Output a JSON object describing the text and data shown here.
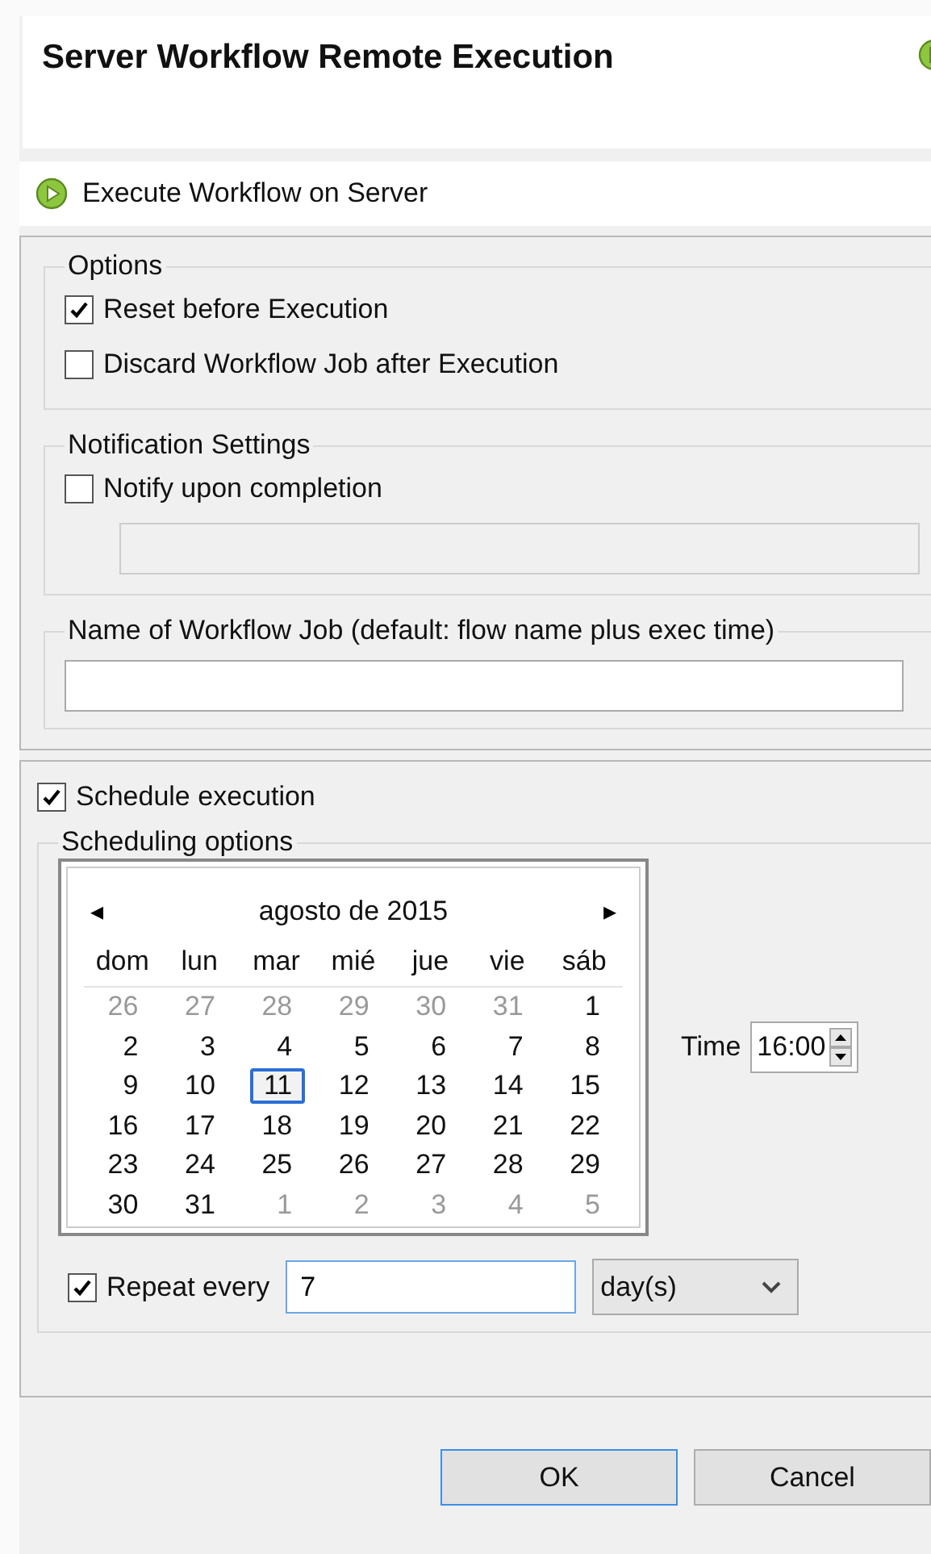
{
  "header": {
    "title": "Server Workflow Remote Execution"
  },
  "action": {
    "label": "Execute Workflow on Server"
  },
  "options": {
    "title": "Options",
    "items": [
      {
        "label": "Reset before Execution",
        "checked": true
      },
      {
        "label": "Discard Workflow Job after Execution",
        "checked": false
      }
    ]
  },
  "notification": {
    "title": "Notification Settings",
    "label": "Notify upon completion",
    "checked": false,
    "disabled": true
  },
  "job_name": {
    "title": "Name of Workflow Job (default: flow name plus exec time)"
  },
  "schedule": {
    "label": "Schedule execution",
    "checked": true,
    "title": "Scheduling options",
    "calendar": {
      "prev": "◂",
      "next": "▸",
      "month": "agosto de 2015",
      "weekdays": [
        "dom",
        "lun",
        "mar",
        "mié",
        "jue",
        "vie",
        "sáb"
      ],
      "days": [
        {
          "day": "26",
          "muted": true,
          "selected": false
        },
        {
          "day": "27",
          "muted": true,
          "selected": false
        },
        {
          "day": "28",
          "muted": true,
          "selected": false
        },
        {
          "day": "29",
          "muted": true,
          "selected": false
        },
        {
          "day": "30",
          "muted": true,
          "selected": false
        },
        {
          "day": "31",
          "muted": true,
          "selected": false
        },
        {
          "day": "1",
          "muted": false,
          "selected": false
        },
        {
          "day": "2",
          "muted": false,
          "selected": false
        },
        {
          "day": "3",
          "muted": false,
          "selected": false
        },
        {
          "day": "4",
          "muted": false,
          "selected": false
        },
        {
          "day": "5",
          "muted": false,
          "selected": false
        },
        {
          "day": "6",
          "muted": false,
          "selected": false
        },
        {
          "day": "7",
          "muted": false,
          "selected": false
        },
        {
          "day": "8",
          "muted": false,
          "selected": false
        },
        {
          "day": "9",
          "muted": false,
          "selected": false
        },
        {
          "day": "10",
          "muted": false,
          "selected": false
        },
        {
          "day": "11",
          "muted": false,
          "selected": true
        },
        {
          "day": "12",
          "muted": false,
          "selected": false
        },
        {
          "day": "13",
          "muted": false,
          "selected": false
        },
        {
          "day": "14",
          "muted": false,
          "selected": false
        },
        {
          "day": "15",
          "muted": false,
          "selected": false
        },
        {
          "day": "16",
          "muted": false,
          "selected": false
        },
        {
          "day": "17",
          "muted": false,
          "selected": false
        },
        {
          "day": "18",
          "muted": false,
          "selected": false
        },
        {
          "day": "19",
          "muted": false,
          "selected": false
        },
        {
          "day": "20",
          "muted": false,
          "selected": false
        },
        {
          "day": "21",
          "muted": false,
          "selected": false
        },
        {
          "day": "22",
          "muted": false,
          "selected": false
        },
        {
          "day": "23",
          "muted": false,
          "selected": false
        },
        {
          "day": "24",
          "muted": false,
          "selected": false
        },
        {
          "day": "25",
          "muted": false,
          "selected": false
        },
        {
          "day": "26",
          "muted": false,
          "selected": false
        },
        {
          "day": "27",
          "muted": false,
          "selected": false
        },
        {
          "day": "28",
          "muted": false,
          "selected": false
        },
        {
          "day": "29",
          "muted": false,
          "selected": false
        },
        {
          "day": "30",
          "muted": false,
          "selected": false
        },
        {
          "day": "31",
          "muted": false,
          "selected": false
        },
        {
          "day": "1",
          "muted": true,
          "selected": false
        },
        {
          "day": "2",
          "muted": true,
          "selected": false
        },
        {
          "day": "3",
          "muted": true,
          "selected": false
        },
        {
          "day": "4",
          "muted": true,
          "selected": false
        },
        {
          "day": "5",
          "muted": true,
          "selected": false
        }
      ]
    },
    "time_label": "Time",
    "time": "16:00",
    "repeat": {
      "label": "Repeat every",
      "checked": true,
      "value": "7",
      "unit": "day(s)"
    }
  },
  "buttons": [
    {
      "label": "OK",
      "default": true
    },
    {
      "label": "Cancel",
      "default": false
    }
  ]
}
